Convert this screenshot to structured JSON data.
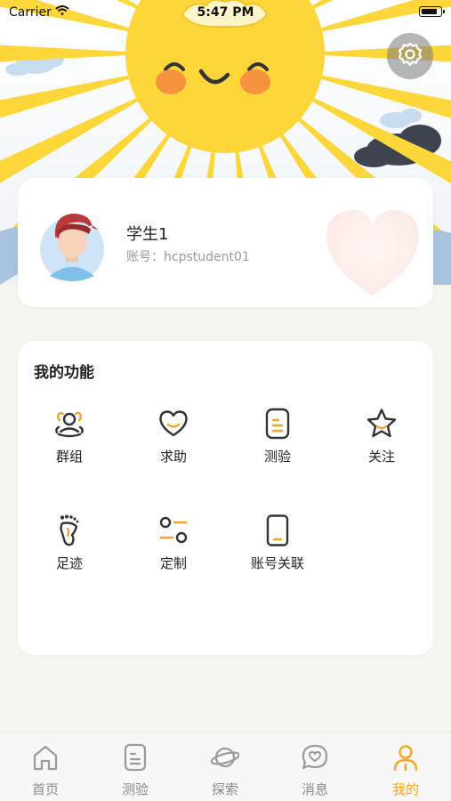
{
  "status_bar": {
    "carrier": "Carrier",
    "time": "5:47 PM",
    "battery_level": 0.9
  },
  "profile": {
    "name": "学生1",
    "account": "账号：hcpstudent01"
  },
  "functions": {
    "title": "我的功能",
    "items": [
      {
        "label": "群组",
        "icon": "group-icon"
      },
      {
        "label": "求助",
        "icon": "heart-outline-icon"
      },
      {
        "label": "测验",
        "icon": "quiz-doc-icon"
      },
      {
        "label": "关注",
        "icon": "star-icon"
      },
      {
        "label": "足迹",
        "icon": "footprint-icon"
      },
      {
        "label": "定制",
        "icon": "customize-icon"
      },
      {
        "label": "账号关联",
        "icon": "phone-link-icon"
      }
    ]
  },
  "tabbar": {
    "active": "mine",
    "items": [
      {
        "key": "home",
        "label": "首页",
        "icon": "home-icon"
      },
      {
        "key": "quiz",
        "label": "测验",
        "icon": "quiz-tab-icon"
      },
      {
        "key": "explore",
        "label": "探索",
        "icon": "planet-icon"
      },
      {
        "key": "messages",
        "label": "消息",
        "icon": "message-heart-icon"
      },
      {
        "key": "mine",
        "label": "我的",
        "icon": "person-icon"
      }
    ]
  },
  "colors": {
    "accent": "#f5a623",
    "sun": "#fdd63a",
    "background": "#f7f5f0"
  }
}
